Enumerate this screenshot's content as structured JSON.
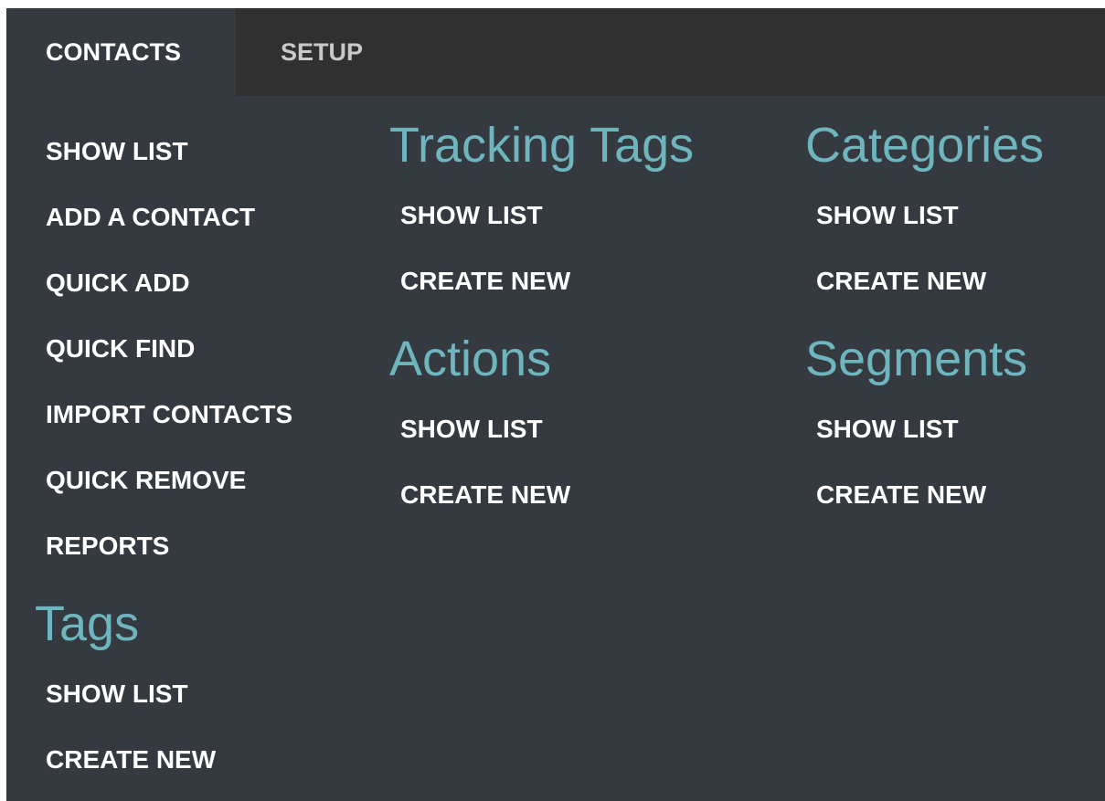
{
  "tabs": {
    "contacts": "CONTACTS",
    "setup": "SETUP"
  },
  "contacts_menu": {
    "show_list": "SHOW LIST",
    "add_contact": "ADD A CONTACT",
    "quick_add": "QUICK ADD",
    "quick_find": "QUICK FIND",
    "import_contacts": "IMPORT CONTACTS",
    "quick_remove": "QUICK REMOVE",
    "reports": "REPORTS"
  },
  "tags": {
    "heading": "Tags",
    "show_list": "SHOW LIST",
    "create_new": "CREATE NEW"
  },
  "tracking_tags": {
    "heading": "Tracking Tags",
    "show_list": "SHOW LIST",
    "create_new": "CREATE NEW"
  },
  "actions": {
    "heading": "Actions",
    "show_list": "SHOW LIST",
    "create_new": "CREATE NEW"
  },
  "categories": {
    "heading": "Categories",
    "show_list": "SHOW LIST",
    "create_new": "CREATE NEW"
  },
  "segments": {
    "heading": "Segments",
    "show_list": "SHOW LIST",
    "create_new": "CREATE NEW"
  },
  "colors": {
    "panel_bg": "#353940",
    "tabbar_bg": "#303030",
    "heading": "#6fb5bd",
    "link": "#ffffff",
    "inactive_tab": "#c9c9c9"
  }
}
